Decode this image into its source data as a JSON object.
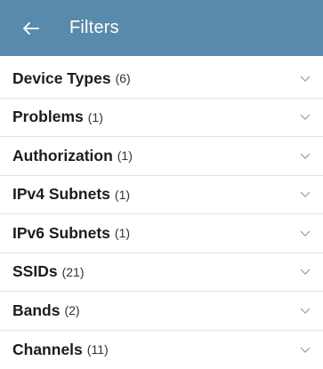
{
  "header": {
    "title": "Filters",
    "back_icon": "arrow-left-icon",
    "background_color": "#5a8aab"
  },
  "filters": [
    {
      "label": "Device Types",
      "count": "(6)"
    },
    {
      "label": "Problems",
      "count": "(1)"
    },
    {
      "label": "Authorization",
      "count": "(1)"
    },
    {
      "label": "IPv4 Subnets",
      "count": "(1)"
    },
    {
      "label": "IPv6 Subnets",
      "count": "(1)"
    },
    {
      "label": "SSIDs",
      "count": "(21)"
    },
    {
      "label": "Bands",
      "count": "(2)"
    },
    {
      "label": "Channels",
      "count": "(11)"
    }
  ],
  "row_icon": "chevron-down-icon"
}
